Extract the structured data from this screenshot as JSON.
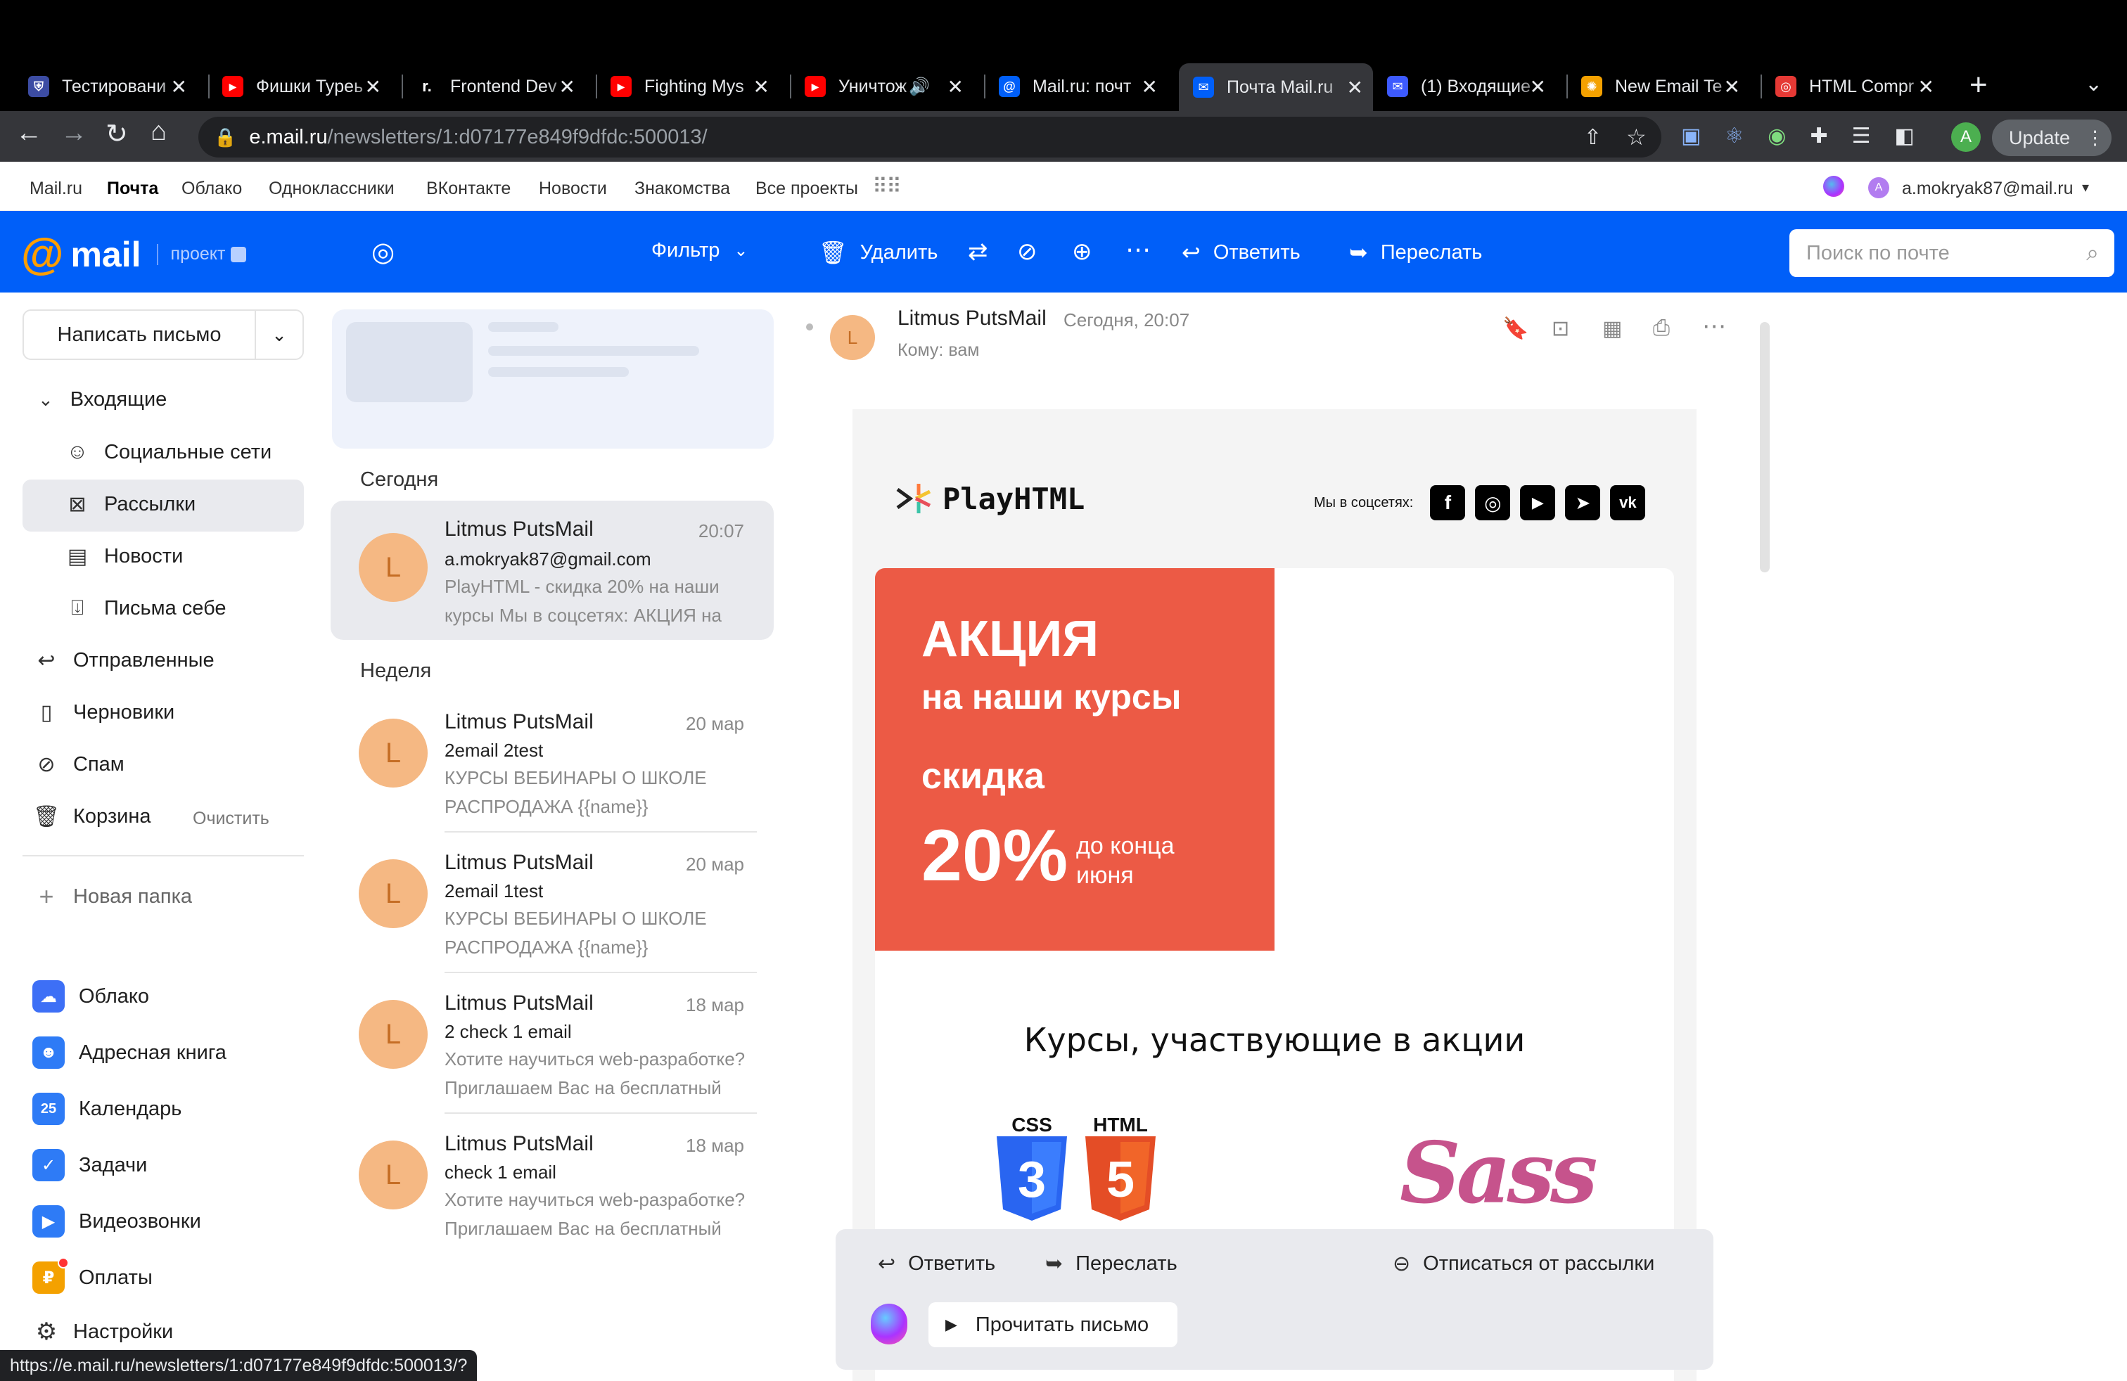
{
  "tabs": [
    {
      "title": "Тестировани",
      "fav_color": "#3c4ca3",
      "fav_glyph": "⛨"
    },
    {
      "title": "Фишки Typeь",
      "fav_color": "#ff0000",
      "fav_glyph": "▶"
    },
    {
      "title": "Frontend Dev",
      "fav_color": "#000000",
      "fav_glyph": "r."
    },
    {
      "title": "Fighting Mys",
      "fav_color": "#ff0000",
      "fav_glyph": "▶"
    },
    {
      "title": "Уничтож",
      "fav_color": "#ff0000",
      "fav_glyph": "▶"
    },
    {
      "title": "Mail.ru: почт",
      "fav_color": "#005ff9",
      "fav_glyph": "@"
    },
    {
      "title": "Почта Mail.ru",
      "fav_color": "#005ff9",
      "fav_glyph": "✉"
    },
    {
      "title": "(1) Входящие",
      "fav_color": "#3d5afe",
      "fav_glyph": "✉"
    },
    {
      "title": "New Email Te",
      "fav_color": "#f4a100",
      "fav_glyph": "✺"
    },
    {
      "title": "HTML Compr",
      "fav_color": "#e53935",
      "fav_glyph": "◎"
    }
  ],
  "browser": {
    "url_host": "e.mail.ru",
    "url_path": "/newsletters/1:d07177e849f9dfdc:500013/",
    "update_label": "Update",
    "profile_letter": "A",
    "status_url": "https://e.mail.ru/newsletters/1:d07177e849f9dfdc:500013/?"
  },
  "portal": {
    "links": [
      "Mail.ru",
      "Почта",
      "Облако",
      "Одноклассники",
      "ВКонтакте",
      "Новости",
      "Знакомства",
      "Все проекты"
    ],
    "account": "a.mokryak87@mail.ru",
    "account_letter": "A"
  },
  "header": {
    "logo": "mail",
    "project": "проект",
    "filter": "Фильтр",
    "delete": "Удалить",
    "reply": "Ответить",
    "forward": "Переслать",
    "search_placeholder": "Поиск по почте"
  },
  "sidebar": {
    "compose": "Написать письмо",
    "inbox": "Входящие",
    "subfolders": [
      "Социальные сети",
      "Рассылки",
      "Новости",
      "Письма себе"
    ],
    "sent": "Отправленные",
    "drafts": "Черновики",
    "spam": "Спам",
    "trash": "Корзина",
    "clear": "Очистить",
    "new_folder": "Новая папка",
    "apps": [
      {
        "label": "Облако",
        "color": "#3d6ff6",
        "glyph": "☁"
      },
      {
        "label": "Адресная книга",
        "color": "#2e7bf6",
        "glyph": "👤"
      },
      {
        "label": "Календарь",
        "color": "#2e7bf6",
        "glyph": "25"
      },
      {
        "label": "Задачи",
        "color": "#2e7bf6",
        "glyph": "✓"
      },
      {
        "label": "Видеозвонки",
        "color": "#2e7bf6",
        "glyph": "■"
      },
      {
        "label": "Оплаты",
        "color": "#f4a100",
        "glyph": "₽"
      }
    ],
    "settings": "Настройки"
  },
  "list": {
    "today": "Сегодня",
    "week": "Неделя",
    "messages": [
      {
        "letter": "L",
        "from": "Litmus PutsMail",
        "date": "20:07",
        "subject": "a.mokryak87@gmail.com",
        "preview": "PlayHTML - скидка 20% на наши курсы Мы в соцсетях: АКЦИЯ на"
      },
      {
        "letter": "L",
        "from": "Litmus PutsMail",
        "date": "20 мар",
        "subject": "2email 2test",
        "preview": "КУРСЫ ВЕБИНАРЫ О ШКОЛЕ РАСПРОДАЖА {{name}}"
      },
      {
        "letter": "L",
        "from": "Litmus PutsMail",
        "date": "20 мар",
        "subject": "2email 1test",
        "preview": "КУРСЫ ВЕБИНАРЫ О ШКОЛЕ РАСПРОДАЖА {{name}}"
      },
      {
        "letter": "L",
        "from": "Litmus PutsMail",
        "date": "18 мар",
        "subject": "2 check 1 email",
        "preview": "Хотите научиться web-разработке? Приглашаем Вас на бесплатный"
      },
      {
        "letter": "L",
        "from": "Litmus PutsMail",
        "date": "18 мар",
        "subject": "check 1 email",
        "preview": "Хотите научиться web-разработке? Приглашаем Вас на бесплатный"
      }
    ]
  },
  "reader": {
    "letter": "L",
    "from": "Litmus PutsMail",
    "date": "Сегодня, 20:07",
    "to": "Кому: вам",
    "brand": "PlayHTML",
    "social_label": "Мы в соцсетях:",
    "promo_title": "АКЦИЯ",
    "promo_sub": "на наши курсы",
    "promo_discount_label": "скидка",
    "promo_percent": "20%",
    "promo_until_1": "до конца",
    "promo_until_2": "июня",
    "promo_color": "#ec5a45",
    "courses_title": "Курсы, участвующие в акции",
    "css_label": "CSS",
    "html_label": "HTML",
    "sass_label": "Sass"
  },
  "bottom": {
    "reply": "Ответить",
    "forward": "Переслать",
    "unsubscribe": "Отписаться от рассылки",
    "read_aloud": "Прочитать письмо"
  }
}
